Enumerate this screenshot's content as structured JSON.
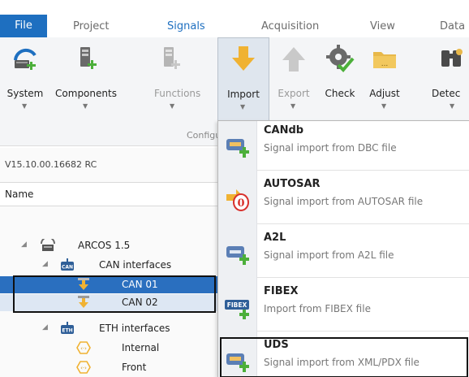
{
  "menu": {
    "tabs": [
      {
        "label": "File"
      },
      {
        "label": "Project"
      },
      {
        "label": "Signals"
      },
      {
        "label": "Acquisition"
      },
      {
        "label": "View"
      },
      {
        "label": "Data"
      }
    ]
  },
  "ribbon": {
    "buttons": [
      {
        "label": "System",
        "icon": "system-icon"
      },
      {
        "label": "Components",
        "icon": "components-icon"
      },
      {
        "label": "Functions",
        "icon": "functions-icon"
      },
      {
        "label": "Import",
        "icon": "import-arrow-icon"
      },
      {
        "label": "Export",
        "icon": "export-arrow-icon"
      },
      {
        "label": "Check",
        "icon": "check-gear-icon"
      },
      {
        "label": "Adjust",
        "icon": "adjust-folder-icon"
      },
      {
        "label": "Detec",
        "icon": "detect-binoculars-icon"
      }
    ],
    "group_label": "Configu"
  },
  "left_panel": {
    "version": "V15.10.00.16682 RC",
    "column_header": "Name",
    "tree": [
      {
        "label": "ARCOS 1.5",
        "icon": "device-icon"
      },
      {
        "label": "CAN interfaces",
        "icon": "can-icon"
      },
      {
        "label": "CAN 01",
        "icon": "can-port-icon"
      },
      {
        "label": "CAN 02",
        "icon": "can-port-icon"
      },
      {
        "label": "ETH interfaces",
        "icon": "eth-icon"
      },
      {
        "label": "Internal",
        "icon": "eth-port-icon"
      },
      {
        "label": "Front",
        "icon": "eth-port-icon"
      }
    ]
  },
  "import_menu": {
    "items": [
      {
        "title": "CANdb",
        "subtitle": "Signal import from DBC file",
        "icon": "candb-icon"
      },
      {
        "title": "AUTOSAR",
        "subtitle": "Signal import from AUTOSAR file",
        "icon": "autosar-icon"
      },
      {
        "title": "A2L",
        "subtitle": "Signal import from A2L file",
        "icon": "a2l-icon"
      },
      {
        "title": "FIBEX",
        "subtitle": "Import from FIBEX file",
        "icon": "fibex-icon",
        "badge": "FIBEX"
      },
      {
        "title": "UDS",
        "subtitle": "Signal import from XML/PDX file",
        "icon": "uds-icon"
      }
    ]
  },
  "colors": {
    "accent": "#1e6fc0",
    "selection": "#2a6fbf",
    "import_arrow": "#f0b232",
    "green_plus": "#4caf3a"
  }
}
